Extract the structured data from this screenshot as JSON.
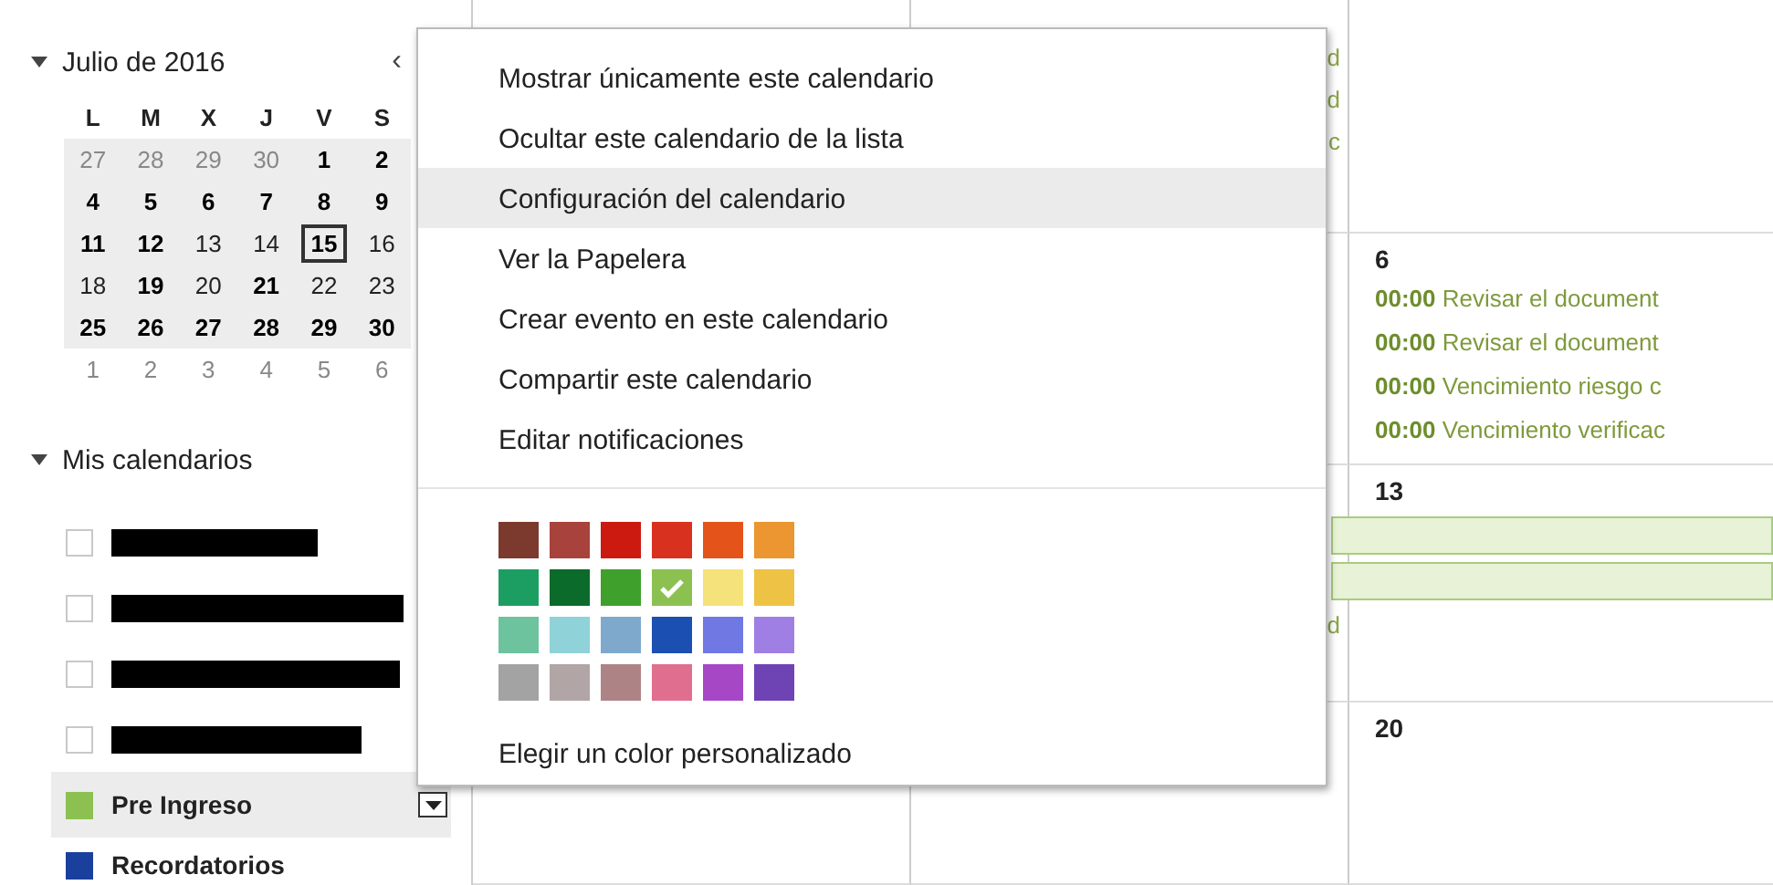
{
  "mini_calendar": {
    "title": "Julio de 2016",
    "prev_button": "‹",
    "weekdays": [
      "L",
      "M",
      "X",
      "J",
      "V",
      "S"
    ],
    "weeks": [
      {
        "in_view": true,
        "days": [
          {
            "label": "27",
            "other_month": true,
            "busy": false,
            "today": false
          },
          {
            "label": "28",
            "other_month": true,
            "busy": false,
            "today": false
          },
          {
            "label": "29",
            "other_month": true,
            "busy": false,
            "today": false
          },
          {
            "label": "30",
            "other_month": true,
            "busy": false,
            "today": false
          },
          {
            "label": "1",
            "other_month": false,
            "busy": true,
            "today": false
          },
          {
            "label": "2",
            "other_month": false,
            "busy": true,
            "today": false
          }
        ]
      },
      {
        "in_view": true,
        "days": [
          {
            "label": "4",
            "other_month": false,
            "busy": true,
            "today": false
          },
          {
            "label": "5",
            "other_month": false,
            "busy": true,
            "today": false
          },
          {
            "label": "6",
            "other_month": false,
            "busy": true,
            "today": false
          },
          {
            "label": "7",
            "other_month": false,
            "busy": true,
            "today": false
          },
          {
            "label": "8",
            "other_month": false,
            "busy": true,
            "today": false
          },
          {
            "label": "9",
            "other_month": false,
            "busy": true,
            "today": false
          }
        ]
      },
      {
        "in_view": true,
        "days": [
          {
            "label": "11",
            "other_month": false,
            "busy": true,
            "today": false
          },
          {
            "label": "12",
            "other_month": false,
            "busy": true,
            "today": false
          },
          {
            "label": "13",
            "other_month": false,
            "busy": false,
            "today": false
          },
          {
            "label": "14",
            "other_month": false,
            "busy": false,
            "today": false
          },
          {
            "label": "15",
            "other_month": false,
            "busy": true,
            "today": true
          },
          {
            "label": "16",
            "other_month": false,
            "busy": false,
            "today": false
          }
        ]
      },
      {
        "in_view": true,
        "days": [
          {
            "label": "18",
            "other_month": false,
            "busy": false,
            "today": false
          },
          {
            "label": "19",
            "other_month": false,
            "busy": true,
            "today": false
          },
          {
            "label": "20",
            "other_month": false,
            "busy": false,
            "today": false
          },
          {
            "label": "21",
            "other_month": false,
            "busy": true,
            "today": false
          },
          {
            "label": "22",
            "other_month": false,
            "busy": false,
            "today": false
          },
          {
            "label": "23",
            "other_month": false,
            "busy": false,
            "today": false
          }
        ]
      },
      {
        "in_view": true,
        "days": [
          {
            "label": "25",
            "other_month": false,
            "busy": true,
            "today": false
          },
          {
            "label": "26",
            "other_month": false,
            "busy": true,
            "today": false
          },
          {
            "label": "27",
            "other_month": false,
            "busy": true,
            "today": false
          },
          {
            "label": "28",
            "other_month": false,
            "busy": true,
            "today": false
          },
          {
            "label": "29",
            "other_month": false,
            "busy": true,
            "today": false
          },
          {
            "label": "30",
            "other_month": false,
            "busy": true,
            "today": false
          }
        ]
      },
      {
        "in_view": false,
        "days": [
          {
            "label": "1",
            "other_month": true,
            "busy": false,
            "today": false
          },
          {
            "label": "2",
            "other_month": true,
            "busy": false,
            "today": false
          },
          {
            "label": "3",
            "other_month": true,
            "busy": false,
            "today": false
          },
          {
            "label": "4",
            "other_month": true,
            "busy": false,
            "today": false
          },
          {
            "label": "5",
            "other_month": true,
            "busy": false,
            "today": false
          },
          {
            "label": "6",
            "other_month": true,
            "busy": false,
            "today": false
          }
        ]
      }
    ]
  },
  "my_calendars": {
    "title": "Mis calendarios",
    "items": [
      {
        "kind": "redacted",
        "visible": false,
        "selected": false
      },
      {
        "kind": "redacted",
        "visible": false,
        "selected": false
      },
      {
        "kind": "redacted",
        "visible": false,
        "selected": false
      },
      {
        "kind": "redacted",
        "visible": false,
        "selected": false
      },
      {
        "kind": "named",
        "name": "Pre Ingreso",
        "visible": true,
        "color": "#8cc152",
        "selected": true
      },
      {
        "kind": "named",
        "name": "Recordatorios",
        "visible": true,
        "color": "#1a3f9c",
        "selected": false
      }
    ]
  },
  "month_view": {
    "weeks": [
      {
        "fragments": [
          "d",
          "d",
          "c"
        ]
      },
      {
        "date": "6",
        "events": [
          {
            "kind": "timed",
            "time": "00:00",
            "title": "Revisar el document"
          },
          {
            "kind": "timed",
            "time": "00:00",
            "title": "Revisar el document"
          },
          {
            "kind": "timed",
            "time": "00:00",
            "title": "Vencimiento riesgo c"
          },
          {
            "kind": "timed",
            "time": "00:00",
            "title": "Vencimiento verificac"
          }
        ]
      },
      {
        "fragments": [
          "d"
        ],
        "date": "13",
        "events": [
          {
            "kind": "allday"
          },
          {
            "kind": "allday"
          }
        ]
      },
      {
        "date": "20"
      }
    ]
  },
  "context_menu": {
    "items": [
      {
        "label": "Mostrar únicamente este calendario",
        "selected": false
      },
      {
        "label": "Ocultar este calendario de la lista",
        "selected": false
      },
      {
        "label": "Configuración del calendario",
        "selected": true
      },
      {
        "label": "Ver la Papelera",
        "selected": false
      },
      {
        "label": "Crear evento en este calendario",
        "selected": false
      },
      {
        "label": "Compartir este calendario",
        "selected": false
      },
      {
        "label": "Editar notificaciones",
        "selected": false
      }
    ],
    "swatches": [
      {
        "color": "#7b3a2d",
        "selected": false
      },
      {
        "color": "#a8423c",
        "selected": false
      },
      {
        "color": "#cc1a10",
        "selected": false
      },
      {
        "color": "#d93120",
        "selected": false
      },
      {
        "color": "#e4541a",
        "selected": false
      },
      {
        "color": "#eb9630",
        "selected": false
      },
      {
        "color": "#1c9e63",
        "selected": false
      },
      {
        "color": "#0b6b2b",
        "selected": false
      },
      {
        "color": "#3fa12b",
        "selected": false
      },
      {
        "color": "#8cc152",
        "selected": true
      },
      {
        "color": "#f5e27a",
        "selected": false
      },
      {
        "color": "#eec345",
        "selected": false
      },
      {
        "color": "#6cc39e",
        "selected": false
      },
      {
        "color": "#8fd2d8",
        "selected": false
      },
      {
        "color": "#7fa9cc",
        "selected": false
      },
      {
        "color": "#1c4fb2",
        "selected": false
      },
      {
        "color": "#6f78e3",
        "selected": false
      },
      {
        "color": "#a07fe5",
        "selected": false
      },
      {
        "color": "#a3a3a3",
        "selected": false
      },
      {
        "color": "#b2a5a5",
        "selected": false
      },
      {
        "color": "#ad8385",
        "selected": false
      },
      {
        "color": "#e06f8f",
        "selected": false
      },
      {
        "color": "#a647c6",
        "selected": false
      },
      {
        "color": "#6e44b5",
        "selected": false
      }
    ],
    "custom_color": "Elegir un color personalizado"
  }
}
